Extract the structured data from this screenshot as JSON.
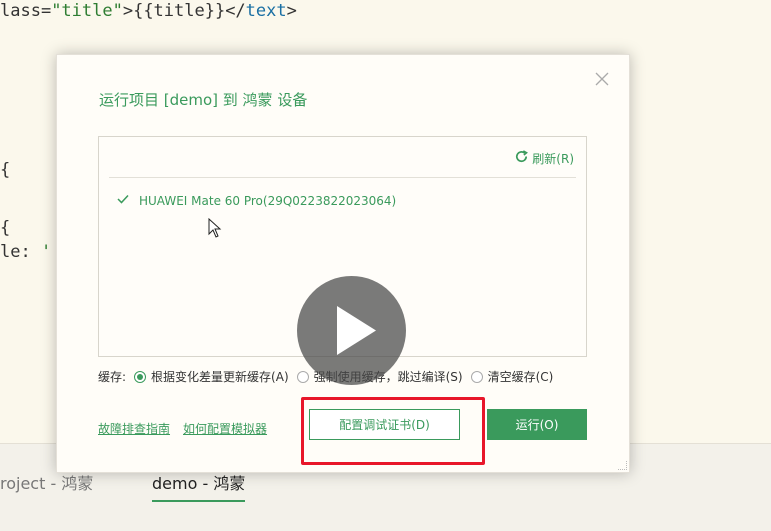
{
  "editor": {
    "line1": {
      "prefix": "lass=",
      "attr": "\"title\"",
      "open": ">{{title}}</",
      "tag": "text",
      "close": ">"
    },
    "line2": "{",
    "line3": "{",
    "line4": {
      "prefix": "le: ",
      "str": "'"
    }
  },
  "bottom_tabs": {
    "tab1": "roject - 鸿蒙",
    "tab2": "demo - 鸿蒙"
  },
  "dialog": {
    "title": "运行项目 [demo] 到 鸿蒙 设备",
    "refresh_label": "刷新(R)",
    "device_name": "HUAWEI Mate 60 Pro(29Q0223822023064)",
    "cache_label": "缓存:",
    "cache_options": [
      "根据变化差量更新缓存(A)",
      "强制使用缓存，跳过编译(S)",
      "清空缓存(C)"
    ],
    "cache_selected": 0,
    "link_troubleshoot": "故障排查指南",
    "link_emulator": "如何配置模拟器",
    "cert_button": "配置调试证书(D)",
    "run_button": "运行(O)"
  },
  "colors": {
    "accent": "#3a9a5c",
    "highlight": "#e8162a"
  },
  "icons": {
    "close": "close-icon",
    "refresh": "refresh-icon",
    "check": "check-icon",
    "play": "play-icon",
    "cursor": "mouse-cursor-icon"
  }
}
